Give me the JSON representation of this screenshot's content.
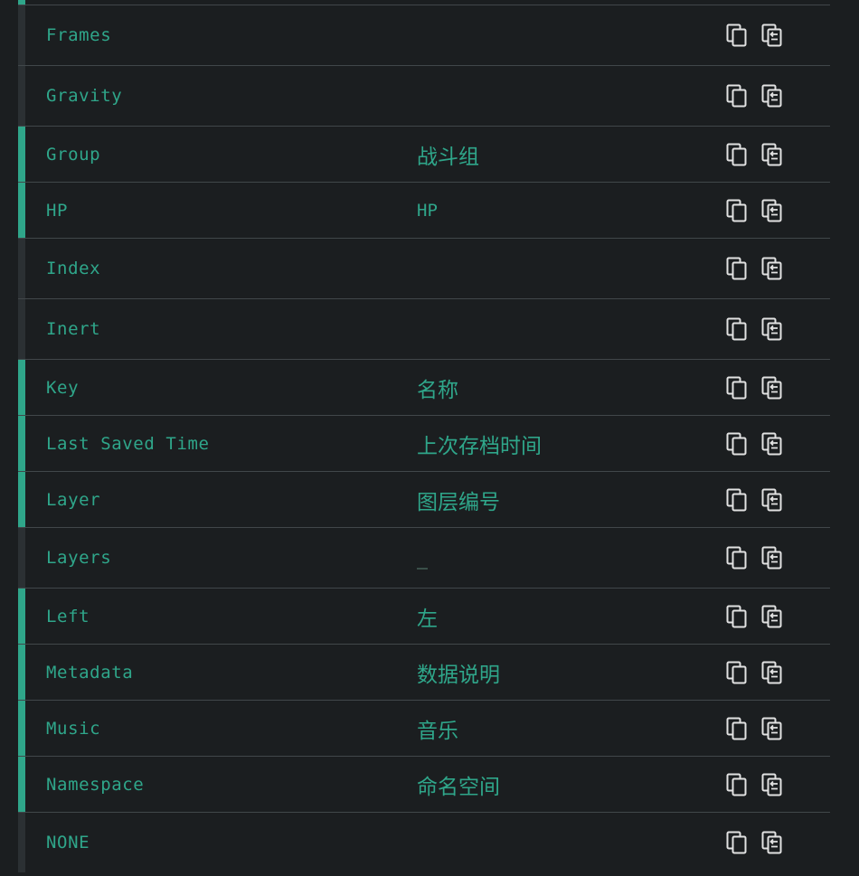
{
  "rows": [
    {
      "key": "Frames",
      "value": ""
    },
    {
      "key": "Gravity",
      "value": ""
    },
    {
      "key": "Group",
      "value": "战斗组"
    },
    {
      "key": "HP",
      "value": "HP"
    },
    {
      "key": "Index",
      "value": ""
    },
    {
      "key": "Inert",
      "value": ""
    },
    {
      "key": "Key",
      "value": "名称"
    },
    {
      "key": "Last Saved Time",
      "value": "上次存档时间"
    },
    {
      "key": "Layer",
      "value": "图层编号"
    },
    {
      "key": "Layers",
      "value": ""
    },
    {
      "key": "Left",
      "value": "左"
    },
    {
      "key": "Metadata",
      "value": "数据说明"
    },
    {
      "key": "Music",
      "value": "音乐"
    },
    {
      "key": "Namespace",
      "value": "命名空间"
    },
    {
      "key": "NONE",
      "value": ""
    }
  ],
  "icons": {
    "copy": "copy-icon",
    "paste": "paste-icon"
  },
  "colors": {
    "background": "#1b1e20",
    "accent": "#2fa68a",
    "text": "#2fa68a",
    "divider": "#41474a",
    "icon": "#e2e2e2",
    "inactive_bar": "#2b3033"
  }
}
